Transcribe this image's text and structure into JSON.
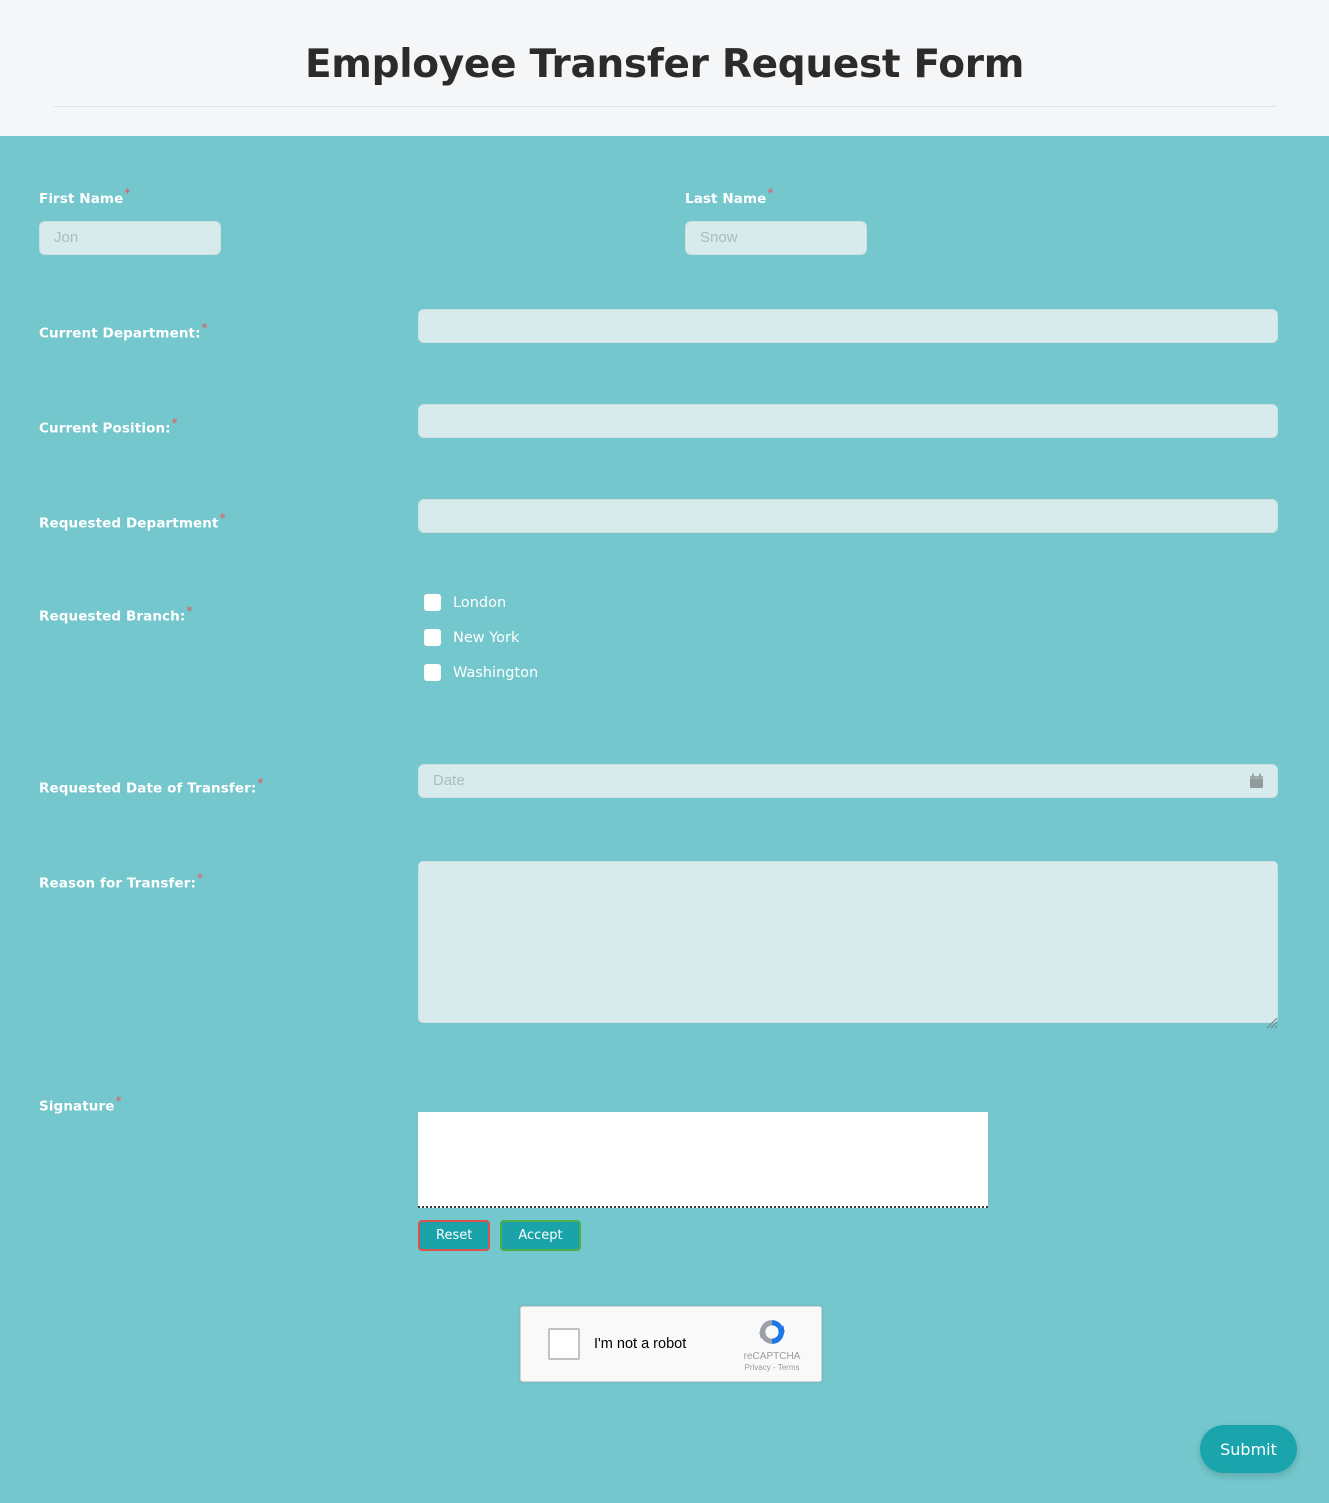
{
  "header": {
    "title": "Employee Transfer Request Form"
  },
  "colors": {
    "page_background": "#f4f6f8",
    "form_background": "#73c7cd",
    "field_background": "#d7eaec",
    "accent": "#1aa5ad",
    "required_asterisk": "#e8555a",
    "reset_border": "#d9534f",
    "accept_border": "#4cae4c"
  },
  "fields": {
    "first_name": {
      "label": "First Name",
      "required": "*",
      "placeholder": "Jon",
      "value": ""
    },
    "last_name": {
      "label": "Last Name",
      "required": "*",
      "placeholder": "Snow",
      "value": ""
    },
    "current_department": {
      "label": "Current Department:",
      "required": "*",
      "placeholder": "",
      "value": ""
    },
    "current_position": {
      "label": "Current Position:",
      "required": "*",
      "placeholder": "",
      "value": ""
    },
    "requested_department": {
      "label": "Requested Department",
      "required": "*",
      "placeholder": "",
      "value": ""
    },
    "requested_branch": {
      "label": "Requested Branch:",
      "required": "*",
      "options": [
        {
          "label": "London",
          "checked": false
        },
        {
          "label": "New York",
          "checked": false
        },
        {
          "label": "Washington",
          "checked": false
        }
      ]
    },
    "requested_date": {
      "label": "Requested Date of Transfer:",
      "required": "*",
      "placeholder": "Date",
      "value": "",
      "icon": "calendar-icon"
    },
    "reason": {
      "label": "Reason for Transfer:",
      "required": "*",
      "placeholder": "",
      "value": ""
    },
    "signature": {
      "label": "Signature",
      "required": "*",
      "reset_label": "Reset",
      "accept_label": "Accept"
    }
  },
  "recaptcha": {
    "checkbox_label": "I'm not a robot",
    "brand": "reCAPTCHA",
    "links": "Privacy - Terms",
    "logo_icon": "recaptcha-logo-icon"
  },
  "actions": {
    "submit_label": "Submit"
  }
}
